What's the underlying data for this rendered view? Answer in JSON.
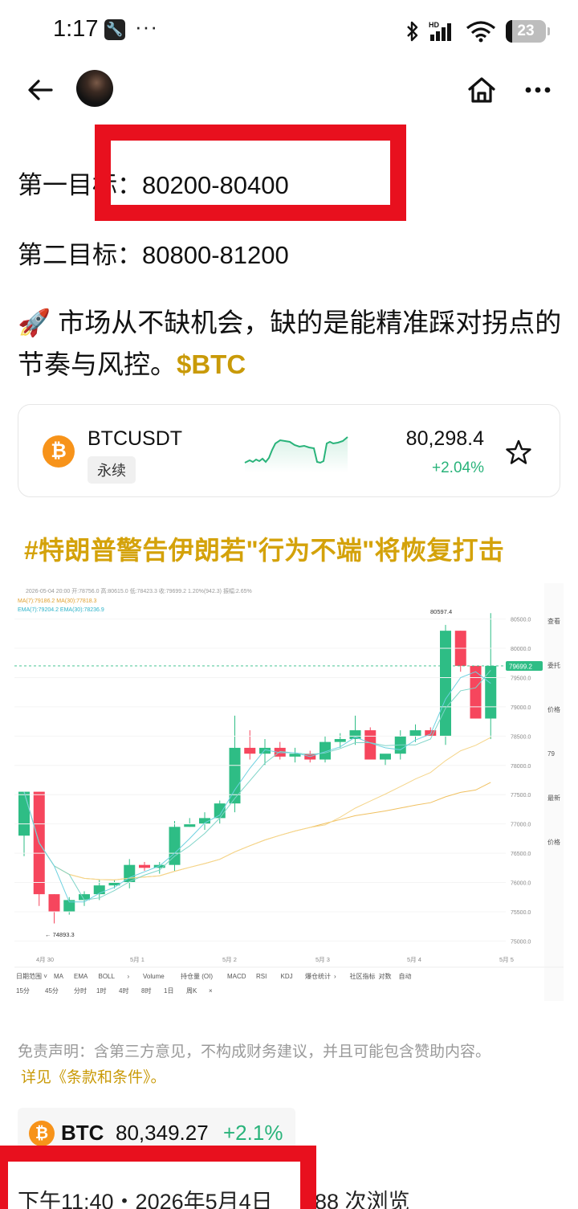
{
  "status_bar": {
    "time": "1:17",
    "more": "···",
    "battery": "23",
    "icons": [
      "wrench-icon",
      "bluetooth-icon",
      "signal-hd-icon",
      "wifi-icon",
      "battery-icon"
    ]
  },
  "nav": {
    "icons": [
      "back-arrow-icon",
      "avatar",
      "home-icon",
      "more-icon"
    ]
  },
  "post": {
    "target1": "第一目标：80200-80400",
    "target2": "第二目标：80800-81200",
    "paragraph_emoji": "🚀",
    "paragraph_text": " 市场从不缺机会，缺的是能精准踩对拐点的节奏与风控。",
    "tag": "$BTC"
  },
  "ticker_card": {
    "coin_glyph": "₿",
    "symbol": "BTCUSDT",
    "badge": "永续",
    "price": "80,298.4",
    "change": "+2.04%",
    "change_color": "#29b37a"
  },
  "hashtag": "#特朗普警告伊朗若\"行为不端\"将恢复打击",
  "chart_data": {
    "type": "candlestick",
    "header": [
      "2026-05-04 20:00 开:78756.0 高:80615.0 低:78423.3 收:79699.2 1.20%(942.3) 振幅:2.65%",
      "MA(7):79186.2  MA(30):77818.3",
      "EMA(7):79204.2  EMA(30):78236.9"
    ],
    "x_labels": [
      "4月 30",
      "5月 1",
      "5月 2",
      "5月 3",
      "5月 4",
      "5月 5"
    ],
    "y_labels": [
      "80500.0",
      "80000.0",
      "79500.0",
      "79000.0",
      "78500.0",
      "78000.0",
      "77500.0",
      "77000.0",
      "76500.0",
      "76000.0",
      "75500.0",
      "75000.0"
    ],
    "ylim": [
      74800,
      80700
    ],
    "last_price": "79699.2",
    "high_label": "80597.4",
    "low_label": "74893.3",
    "ohlc": [
      [
        76800,
        77550,
        76450,
        77550
      ],
      [
        77550,
        77550,
        75600,
        75800
      ],
      [
        75800,
        75800,
        75300,
        75500
      ],
      [
        75500,
        75750,
        75450,
        75700
      ],
      [
        75700,
        75850,
        75600,
        75800
      ],
      [
        75800,
        76050,
        75700,
        75950
      ],
      [
        75950,
        76050,
        75900,
        76000
      ],
      [
        76000,
        76400,
        75900,
        76300
      ],
      [
        76300,
        76350,
        76200,
        76250
      ],
      [
        76250,
        76350,
        76150,
        76300
      ],
      [
        76300,
        77050,
        76200,
        76950
      ],
      [
        76950,
        77100,
        76950,
        77000
      ],
      [
        77000,
        77200,
        76900,
        77100
      ],
      [
        77100,
        77400,
        77000,
        77350
      ],
      [
        77350,
        78850,
        77200,
        78300
      ],
      [
        78300,
        78600,
        78100,
        78200
      ],
      [
        78200,
        78450,
        78000,
        78300
      ],
      [
        78300,
        78400,
        78100,
        78150
      ],
      [
        78150,
        78300,
        78050,
        78200
      ],
      [
        78200,
        78250,
        78050,
        78100
      ],
      [
        78100,
        78500,
        78050,
        78400
      ],
      [
        78400,
        78550,
        78300,
        78450
      ],
      [
        78450,
        78850,
        78350,
        78600
      ],
      [
        78600,
        78650,
        78250,
        78100
      ],
      [
        78100,
        78150,
        78000,
        78200
      ],
      [
        78200,
        78600,
        78100,
        78500
      ],
      [
        78500,
        78700,
        78400,
        78600
      ],
      [
        78600,
        78650,
        78500,
        78500
      ],
      [
        78500,
        80400,
        78350,
        80300
      ],
      [
        80300,
        80300,
        79600,
        79700
      ],
      [
        79700,
        79700,
        78800,
        78800
      ],
      [
        78800,
        80600,
        78450,
        79700
      ]
    ],
    "toolbar_row1": [
      "日期范围 ˅",
      "MA",
      "EMA",
      "BOLL",
      "›",
      "Volume",
      "持仓量 (OI)",
      "MACD",
      "RSI",
      "KDJ",
      "爆仓统计",
      "›",
      "社区指标",
      "对数",
      "自动"
    ],
    "toolbar_row2": [
      "15分",
      "45分",
      "分时",
      "1时",
      "4时",
      "8时",
      "1日",
      "周K",
      "×"
    ],
    "right_panel": [
      "查看",
      "委托",
      "价格",
      "79",
      "最新",
      "价格"
    ]
  },
  "disclaimer": "免责声明：含第三方意见，不构成财务建议，并且可能包含赞助内容。",
  "terms_link": "详见《条款和条件》。",
  "price_pill": {
    "coin_glyph": "₿",
    "symbol": "BTC",
    "price": "80,349.27",
    "change": "+2.1%"
  },
  "footer": {
    "time": "下午11:40・2026年5月4日",
    "views": "88 次浏览"
  }
}
